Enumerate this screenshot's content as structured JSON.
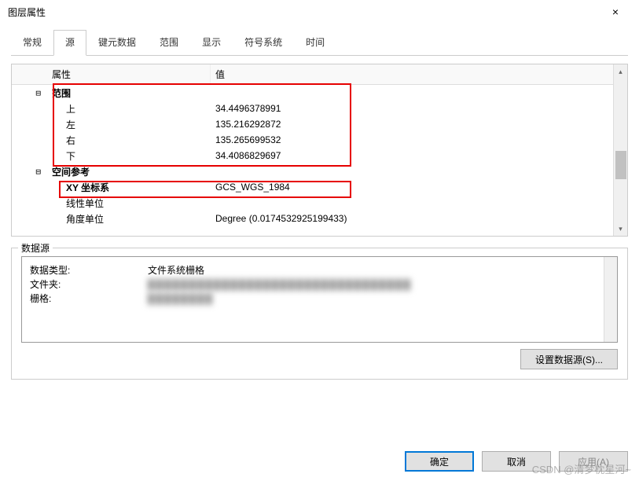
{
  "window": {
    "title": "图层属性",
    "close": "×"
  },
  "tabs": {
    "items": [
      {
        "label": "常规"
      },
      {
        "label": "源"
      },
      {
        "label": "键元数据"
      },
      {
        "label": "范围"
      },
      {
        "label": "显示"
      },
      {
        "label": "符号系统"
      },
      {
        "label": "时间"
      }
    ],
    "active": 1
  },
  "properties": {
    "header": {
      "property": "属性",
      "value": "值"
    },
    "groups": [
      {
        "name": "范围",
        "expand": "⊟",
        "rows": [
          {
            "key": "上",
            "value": "34.4496378991"
          },
          {
            "key": "左",
            "value": "135.216292872"
          },
          {
            "key": "右",
            "value": "135.265699532"
          },
          {
            "key": "下",
            "value": "34.4086829697"
          }
        ]
      },
      {
        "name": "空间参考",
        "expand": "⊟",
        "rows": [
          {
            "key": "XY 坐标系",
            "value": "GCS_WGS_1984",
            "bold": true
          },
          {
            "key": "线性单位",
            "value": ""
          },
          {
            "key": "角度单位",
            "value": "Degree (0.0174532925199433)"
          }
        ]
      }
    ]
  },
  "datasource": {
    "legend": "数据源",
    "rows": [
      {
        "k": "数据类型:",
        "v": "文件系统栅格"
      },
      {
        "k": "文件夹:",
        "v": ""
      },
      {
        "k": "栅格:",
        "v": ""
      }
    ],
    "set_button": "设置数据源(S)..."
  },
  "footer": {
    "ok": "确定",
    "cancel": "取消",
    "apply": "应用(A)"
  },
  "watermark": "CSDN @清梦枕星河~"
}
